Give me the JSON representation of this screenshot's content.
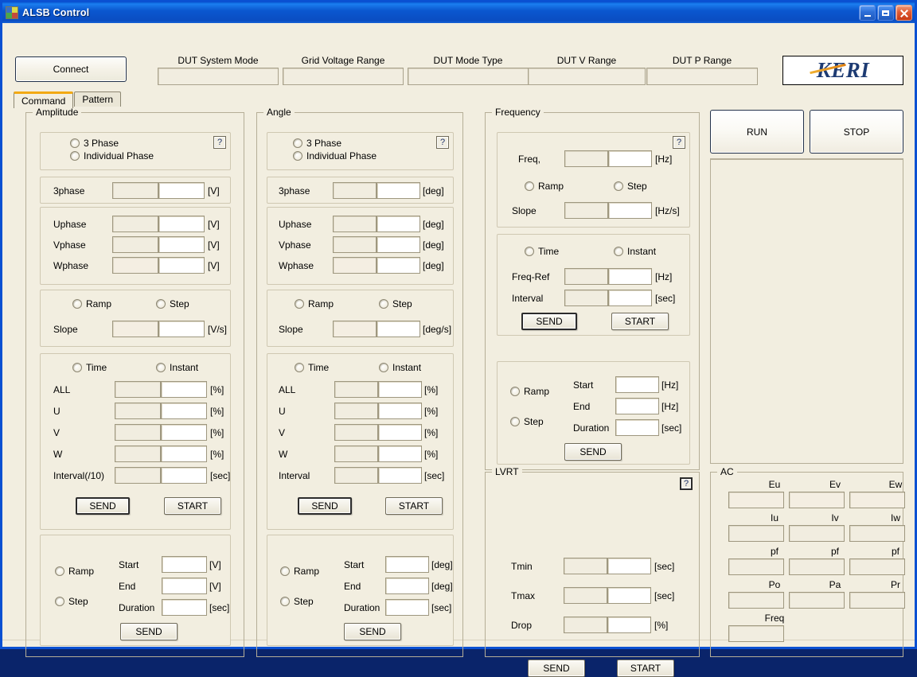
{
  "window": {
    "title": "ALSB Control",
    "icon": "app-icon",
    "buttons": {
      "minimize": "minimize",
      "maximize": "maximize",
      "close": "close"
    }
  },
  "header": {
    "connect_label": "Connect",
    "logo_text": "KERI",
    "status_fields": [
      {
        "label": "DUT System Mode",
        "value": ""
      },
      {
        "label": "Grid Voltage Range",
        "value": ""
      },
      {
        "label": "DUT Mode Type",
        "value": ""
      },
      {
        "label": "DUT V Range",
        "value": ""
      },
      {
        "label": "DUT P Range",
        "value": ""
      }
    ]
  },
  "tabs": [
    {
      "label": "Command",
      "active": true
    },
    {
      "label": "Pattern",
      "active": false
    }
  ],
  "common": {
    "help": "?",
    "send": "SEND",
    "start_btn": "START",
    "radio_3phase": "3 Phase",
    "radio_individual": "Individual Phase",
    "radio_ramp": "Ramp",
    "radio_step": "Step",
    "radio_time": "Time",
    "radio_instant": "Instant",
    "lbl_slope": "Slope",
    "lbl_start": "Start",
    "lbl_end": "End",
    "lbl_duration": "Duration",
    "lbl_all": "ALL",
    "lbl_u": "U",
    "lbl_v": "V",
    "lbl_w": "W"
  },
  "units": {
    "volt": "[V]",
    "volt_per_s": "[V/s]",
    "deg": "[deg]",
    "deg_per_s": "[deg/s]",
    "hz": "[Hz]",
    "hz_per_s": "[Hz/s]",
    "sec": "[sec]",
    "percent": "[%]"
  },
  "amplitude": {
    "title": "Amplitude",
    "lbl_3phase": "3phase",
    "lbl_uphase": "Uphase",
    "lbl_vphase": "Vphase",
    "lbl_wphase": "Wphase",
    "lbl_interval": "Interval(/10)",
    "v_3phase": "",
    "v_3phase_set": "",
    "v_u": "",
    "v_u_set": "",
    "v_v": "",
    "v_v_set": "",
    "v_w": "",
    "v_w_set": "",
    "v_slope": "",
    "v_slope_set": "",
    "p_all": "",
    "p_all_set": "",
    "p_u": "",
    "p_u_set": "",
    "p_v": "",
    "p_v_set": "",
    "p_w": "",
    "p_w_set": "",
    "p_interval": "",
    "p_interval_set": "",
    "r_start": "",
    "r_end": "",
    "r_duration": ""
  },
  "angle": {
    "title": "Angle",
    "lbl_3phase": "3phase",
    "lbl_uphase": "Uphase",
    "lbl_vphase": "Vphase",
    "lbl_wphase": "Wphase",
    "lbl_interval": "Interval",
    "a_3phase": "",
    "a_3phase_set": "",
    "a_u": "",
    "a_u_set": "",
    "a_v": "",
    "a_v_set": "",
    "a_w": "",
    "a_w_set": "",
    "a_slope": "",
    "a_slope_set": "",
    "p_all": "",
    "p_all_set": "",
    "p_u": "",
    "p_u_set": "",
    "p_v": "",
    "p_v_set": "",
    "p_w": "",
    "p_w_set": "",
    "p_interval": "",
    "p_interval_set": "",
    "r_start": "",
    "r_end": "",
    "r_duration": ""
  },
  "frequency": {
    "title": "Frequency",
    "lbl_freq": "Freq,",
    "lbl_freq_ref": "Freq-Ref",
    "lbl_interval": "Interval",
    "f_val": "",
    "f_val_set": "",
    "f_slope": "",
    "f_slope_set": "",
    "f_ref": "",
    "f_ref_set": "",
    "f_interval": "",
    "f_interval_set": "",
    "r_start": "",
    "r_end": "",
    "r_duration": ""
  },
  "lvrt": {
    "title": "LVRT",
    "lbl_tmin": "Tmin",
    "lbl_tmax": "Tmax",
    "lbl_drop": "Drop",
    "tmin": "",
    "tmin_set": "",
    "tmax": "",
    "tmax_set": "",
    "drop": "",
    "drop_set": ""
  },
  "run_controls": {
    "run": "RUN",
    "stop": "STOP",
    "log": ""
  },
  "ac": {
    "title": "AC",
    "rows": [
      {
        "cells": [
          {
            "label": "Eu",
            "value": ""
          },
          {
            "label": "Ev",
            "value": ""
          },
          {
            "label": "Ew",
            "value": ""
          }
        ]
      },
      {
        "cells": [
          {
            "label": "Iu",
            "value": ""
          },
          {
            "label": "Iv",
            "value": ""
          },
          {
            "label": "Iw",
            "value": ""
          }
        ]
      },
      {
        "cells": [
          {
            "label": "pf",
            "value": ""
          },
          {
            "label": "pf",
            "value": ""
          },
          {
            "label": "pf",
            "value": ""
          }
        ]
      },
      {
        "cells": [
          {
            "label": "Po",
            "value": ""
          },
          {
            "label": "Pa",
            "value": ""
          },
          {
            "label": "Pr",
            "value": ""
          }
        ]
      },
      {
        "cells": [
          {
            "label": "Freq",
            "value": ""
          }
        ]
      }
    ]
  }
}
